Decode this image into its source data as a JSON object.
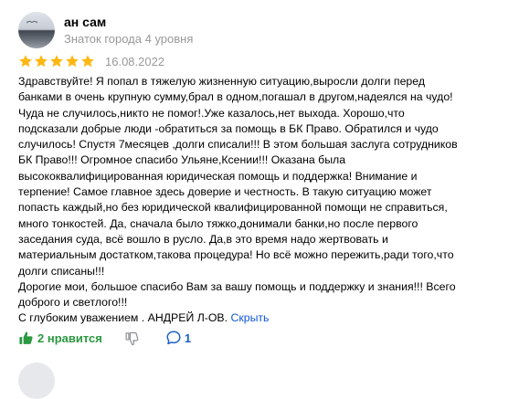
{
  "review": {
    "author": "ан сам",
    "author_level": "Знаток города 4 уровня",
    "rating": 5,
    "date": "16.08.2022",
    "text_lines": [
      "Здравствуйте! Я попал в тяжелую жизненную ситуацию,выросли долги перед",
      "банками в очень крупную сумму,брал в одном,погашал в другом,надеялся на чудо!",
      "Чуда не случилось,никто не помог!.Уже казалось,нет выхода. Хорошо,что",
      "подсказали добрые люди -обратиться за помощь в БК Право. Обратился и чудо",
      "случилось! Спустя 7месяцев ,долги списали!!! В этом большая заслуга сотрудников",
      "БК Право!!! Огромное спасибо Ульяне,Ксении!!! Оказана была",
      "высококвалифицированная юридическая помощь и поддержка! Внимание и",
      "терпение! Самое главное здесь доверие и честность. В такую ситуацию может",
      "попасть каждый,но без юридической квалифицированной помощи не справиться,",
      "много тонкостей. Да, сначала было тяжко,донимали банки,но после первого",
      "заседания суда, всё вошло в русло. Да,в это время надо жертвовать и",
      "материальным достатком,такова процедура! Но всё можно пережить,ради того,что",
      "долги списаны!!!",
      "Дорогие мои, большое спасибо Вам за вашу помощь и поддержку и знания!!! Всего",
      "доброго и светлого!!!"
    ],
    "signature": "С глубоким уважением . АНДРЕЙ Л-ОВ.",
    "hide_link": "Скрыть"
  },
  "actions": {
    "like_label": "2 нравится",
    "comments_count": "1"
  },
  "colors": {
    "star": "#fdb813",
    "like": "#2b9940",
    "link": "#0d56d6",
    "muted": "#999999",
    "comments": "#1a5fc4"
  },
  "icons": {
    "like": "thumbs-up-icon",
    "dislike": "thumbs-down-icon",
    "comments": "comment-bubble-icon",
    "star": "star-icon"
  }
}
